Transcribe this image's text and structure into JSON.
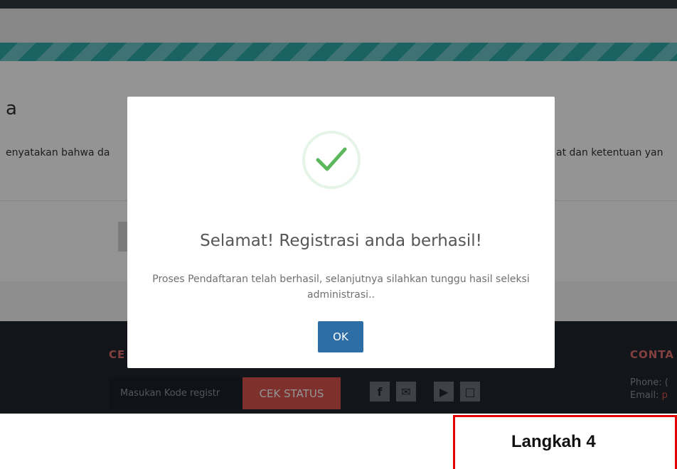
{
  "background": {
    "heading_fragment": "a",
    "text_left": "enyatakan bahwa da",
    "text_right": "at dan ketentuan yan"
  },
  "footer": {
    "left_title": "CE",
    "right_title": "CONTA",
    "kode_placeholder": "Masukan Kode registr",
    "cek_button": "CEK STATUS",
    "social_icons": [
      "facebook-icon",
      "twitter-icon",
      "youtube-icon",
      "instagram-icon"
    ],
    "social_glyphs": [
      "f",
      "✉",
      "▶",
      "□"
    ],
    "phone_label": "Phone: (",
    "email_label": "Email: ",
    "email_value": "p"
  },
  "modal": {
    "title": "Selamat! Registrasi anda berhasil!",
    "text": "Proses Pendaftaran telah berhasil, selanjutnya silahkan tunggu hasil seleksi administrasi..",
    "ok_button": "OK",
    "icon": "checkmark-icon",
    "success_color": "#5cb85c"
  },
  "annotation": {
    "label": "Langkah 4",
    "border_color": "#e00000"
  }
}
